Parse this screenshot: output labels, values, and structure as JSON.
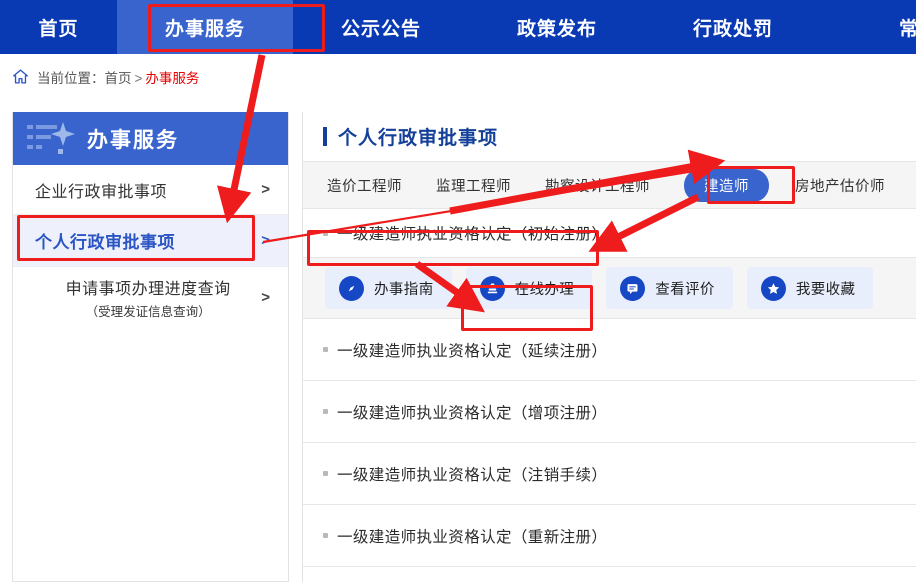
{
  "topnav": {
    "items": [
      {
        "label": "首页",
        "active": false
      },
      {
        "label": "办事服务",
        "active": true
      },
      {
        "label": "公示公告",
        "active": false
      },
      {
        "label": "政策发布",
        "active": false
      },
      {
        "label": "行政处罚",
        "active": false
      },
      {
        "label": "常",
        "active": false
      }
    ]
  },
  "breadcrumb": {
    "home_icon": "home-icon",
    "prefix": "当前位置：",
    "root": "首页",
    "separator": ">",
    "current": "办事服务"
  },
  "sidebar": {
    "title": "办事服务",
    "items": [
      {
        "label": "企业行政审批事项",
        "sub": "",
        "arrow": ">",
        "active": false
      },
      {
        "label": "个人行政审批事项",
        "sub": "",
        "arrow": ">",
        "active": true
      },
      {
        "label": "申请事项办理进度查询",
        "sub": "（受理发证信息查询）",
        "arrow": ">",
        "active": false
      }
    ]
  },
  "main": {
    "title": "个人行政审批事项",
    "tabs": [
      {
        "label": "造价工程师",
        "active": false
      },
      {
        "label": "监理工程师",
        "active": false
      },
      {
        "label": "勘察设计工程师",
        "active": false
      },
      {
        "label": "建造师",
        "active": true
      },
      {
        "label": "房地产估价师",
        "active": false
      }
    ],
    "selected_item": "一级建造师执业资格认定（初始注册）",
    "actions": [
      {
        "label": "办事指南",
        "icon": "compass-icon"
      },
      {
        "label": "在线办理",
        "icon": "stamp-icon"
      },
      {
        "label": "查看评价",
        "icon": "comment-icon"
      },
      {
        "label": "我要收藏",
        "icon": "star-icon"
      }
    ],
    "items": [
      "一级建造师执业资格认定（延续注册）",
      "一级建造师执业资格认定（增项注册）",
      "一级建造师执业资格认定（注销手续）",
      "一级建造师执业资格认定（重新注册）"
    ]
  },
  "colors": {
    "nav_blue": "#0a3ab3",
    "accent_blue": "#3a64cd",
    "title_blue": "#14409a",
    "annotation_red": "#ee1c1c",
    "action_bg": "#e8eefc"
  }
}
